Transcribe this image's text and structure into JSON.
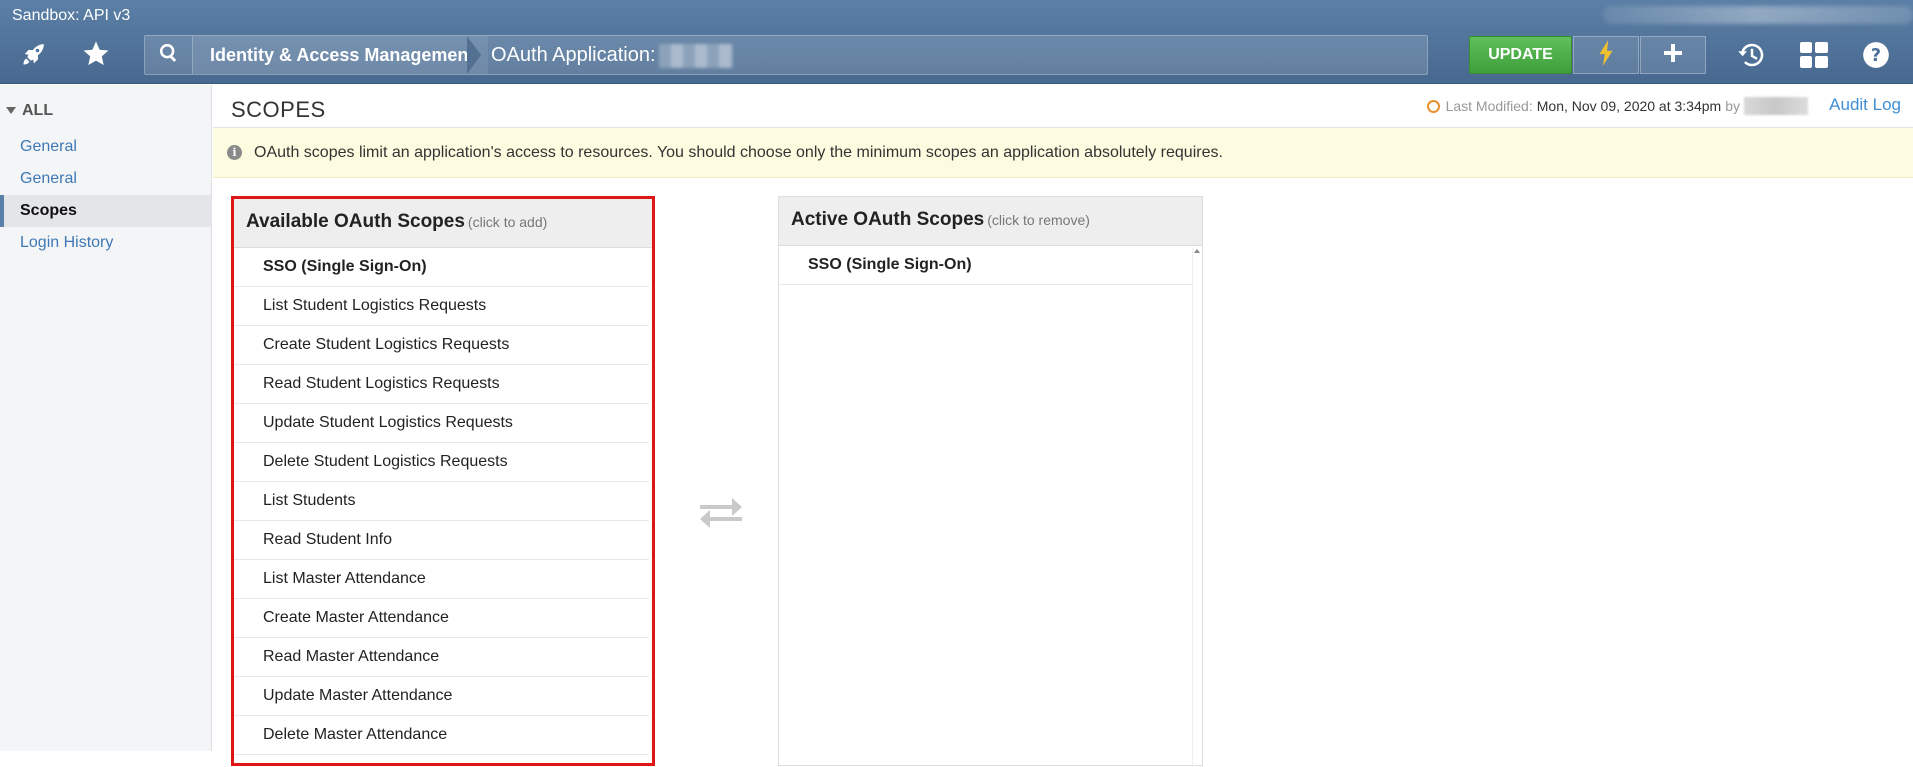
{
  "topbar": {
    "env_label": "Sandbox: API v3",
    "breadcrumb_section": "Identity & Access Management",
    "breadcrumb_page": "OAuth Application:",
    "update_label": "UPDATE"
  },
  "sidebar": {
    "root_label": "ALL",
    "items": [
      {
        "label": "General",
        "active": false
      },
      {
        "label": "General",
        "active": false
      },
      {
        "label": "Scopes",
        "active": true
      },
      {
        "label": "Login History",
        "active": false
      }
    ]
  },
  "main": {
    "title": "SCOPES",
    "last_modified_label": "Last Modified:",
    "last_modified_value": "Mon, Nov 09, 2020 at 3:34pm",
    "by_label": "by",
    "audit_log": "Audit Log",
    "notice": "OAuth scopes limit an application's access to resources. You should choose only the minimum scopes an application absolutely requires."
  },
  "available": {
    "title": "Available OAuth Scopes",
    "hint": "(click to add)",
    "items": [
      {
        "label": "SSO (Single Sign-On)",
        "bold": true
      },
      {
        "label": "List Student Logistics Requests",
        "bold": false
      },
      {
        "label": "Create Student Logistics Requests",
        "bold": false
      },
      {
        "label": "Read Student Logistics Requests",
        "bold": false
      },
      {
        "label": "Update Student Logistics Requests",
        "bold": false
      },
      {
        "label": "Delete Student Logistics Requests",
        "bold": false
      },
      {
        "label": "List Students",
        "bold": false
      },
      {
        "label": "Read Student Info",
        "bold": false
      },
      {
        "label": "List Master Attendance",
        "bold": false
      },
      {
        "label": "Create Master Attendance",
        "bold": false
      },
      {
        "label": "Read Master Attendance",
        "bold": false
      },
      {
        "label": "Update Master Attendance",
        "bold": false
      },
      {
        "label": "Delete Master Attendance",
        "bold": false
      }
    ]
  },
  "active": {
    "title": "Active OAuth Scopes",
    "hint": "(click to remove)",
    "items": [
      {
        "label": "SSO (Single Sign-On)",
        "bold": true
      }
    ]
  },
  "icons": {
    "rocket": "rocket-icon",
    "star": "star-icon",
    "search": "search-icon",
    "bolt": "lightning-bolt-icon",
    "plus": "plus-icon",
    "history": "history-icon",
    "apps": "apps-grid-icon",
    "help": "help-icon",
    "info": "info-icon",
    "clock": "clock-icon",
    "transfer": "transfer-arrows-icon"
  },
  "colors": {
    "topbar": "#5175a0",
    "update_green": "#4caf48",
    "bolt_yellow": "#f2c12e",
    "link_blue": "#3f78b5",
    "notice_bg": "#fdfce0",
    "highlight_red": "#e01515"
  }
}
